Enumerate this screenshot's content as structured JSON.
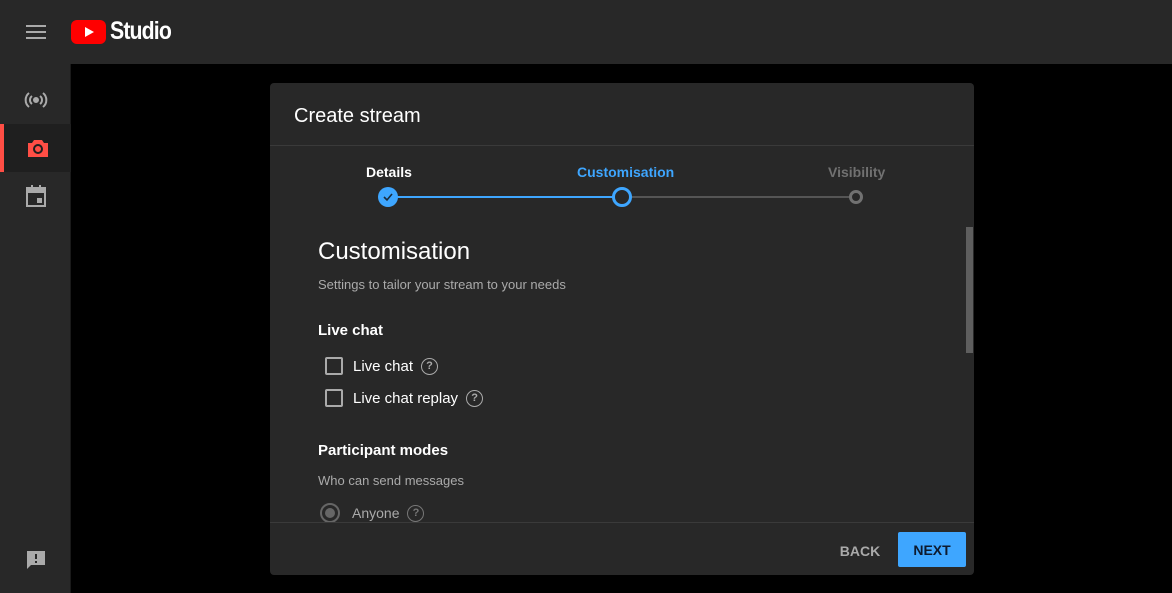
{
  "app": {
    "logo_text": "Studio"
  },
  "sidebar": {
    "items": [
      {
        "icon": "live-broadcast-icon"
      },
      {
        "icon": "camera-icon",
        "active": true
      },
      {
        "icon": "calendar-icon"
      }
    ],
    "feedback_icon": "feedback-icon"
  },
  "dialog": {
    "title": "Create stream",
    "steps": [
      {
        "label": "Details",
        "state": "done"
      },
      {
        "label": "Customisation",
        "state": "current"
      },
      {
        "label": "Visibility",
        "state": "upcoming"
      }
    ],
    "heading": "Customisation",
    "subheading": "Settings to tailor your stream to your needs",
    "live_chat": {
      "title": "Live chat",
      "options": [
        {
          "label": "Live chat",
          "checked": false
        },
        {
          "label": "Live chat replay",
          "checked": false
        }
      ]
    },
    "participant": {
      "title": "Participant modes",
      "subtitle": "Who can send messages",
      "options": [
        {
          "label": "Anyone",
          "selected": true
        }
      ]
    },
    "back": "BACK",
    "next": "NEXT"
  },
  "colors": {
    "accent": "#3ea6ff",
    "brand": "#ff0000",
    "active": "#ff4e45"
  }
}
